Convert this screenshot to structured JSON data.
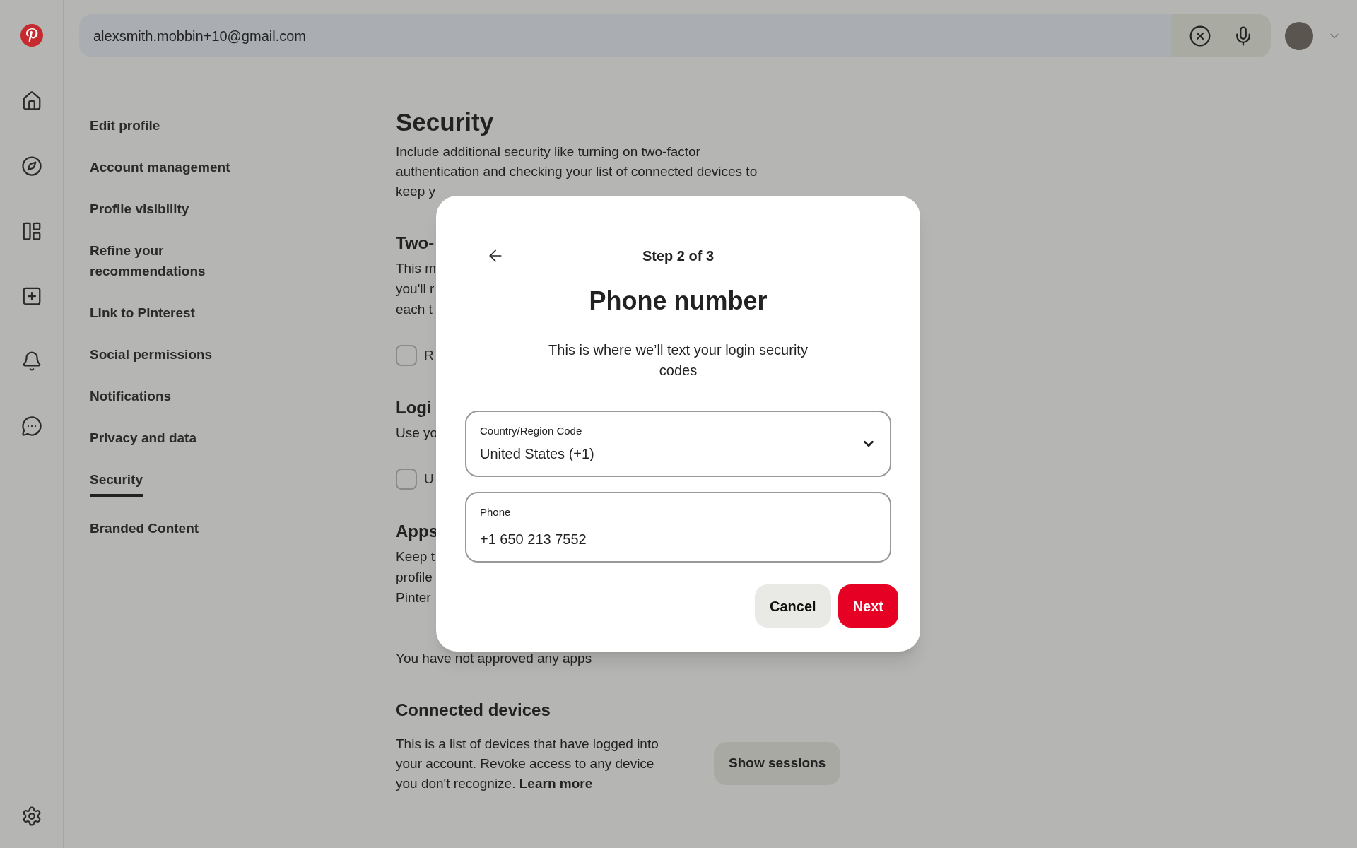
{
  "search": {
    "value": "alexsmith.mobbin+10@gmail.com"
  },
  "settings_nav": [
    {
      "label": "Edit profile",
      "selected": false
    },
    {
      "label": "Account management",
      "selected": false
    },
    {
      "label": "Profile visibility",
      "selected": false
    },
    {
      "label": "Refine your recommendations",
      "selected": false
    },
    {
      "label": "Link to Pinterest",
      "selected": false
    },
    {
      "label": "Social permissions",
      "selected": false
    },
    {
      "label": "Notifications",
      "selected": false
    },
    {
      "label": "Privacy and data",
      "selected": false
    },
    {
      "label": "Security",
      "selected": true
    },
    {
      "label": "Branded Content",
      "selected": false
    }
  ],
  "page": {
    "title": "Security",
    "intro": [
      "Include additional security like turning on two-factor",
      "authentication and checking your list of connected devices to",
      "keep y"
    ],
    "sections": [
      {
        "heading": "Two-",
        "lines": [
          "This m",
          "you'll r",
          "each t"
        ],
        "checkbox": {
          "label": "R",
          "checked": false
        }
      },
      {
        "heading": "Logi",
        "lines": [
          "Use yo"
        ],
        "checkbox": {
          "label": "U",
          "checked": false
        }
      },
      {
        "heading": "Apps",
        "lines": [
          "Keep t",
          "profile",
          "Pinter"
        ],
        "note": "You have not approved any apps"
      }
    ],
    "devices": {
      "heading": "Connected devices",
      "text": "This is a list of devices that have logged into your account. Revoke access to any device you don't recognize.",
      "link": "Learn more",
      "button": "Show sessions"
    }
  },
  "dialog": {
    "step": "Step 2 of 3",
    "title": "Phone number",
    "description": "This is where we’ll text your login security codes",
    "country": {
      "label": "Country/Region Code",
      "value": "United States (+1)"
    },
    "phone": {
      "label": "Phone",
      "value": "+1 650 213 7552"
    },
    "buttons": [
      {
        "label": "Cancel",
        "kind": "secondary"
      },
      {
        "label": "Next",
        "kind": "primary"
      }
    ]
  }
}
